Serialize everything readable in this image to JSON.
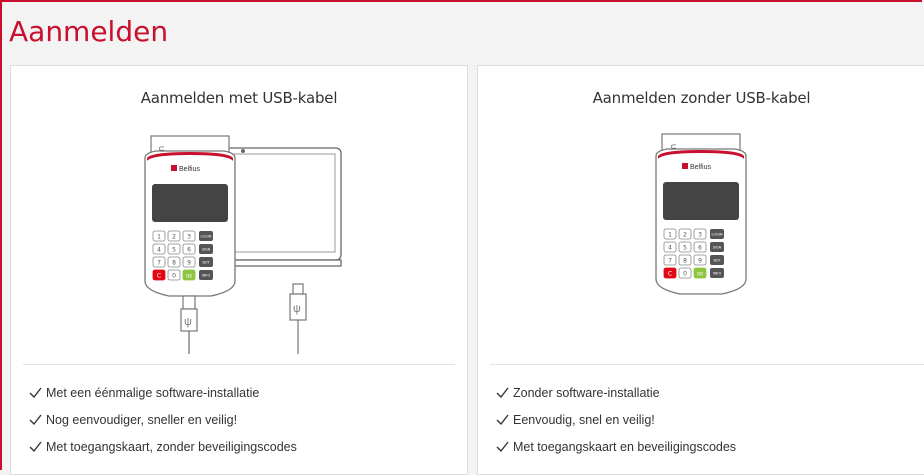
{
  "page": {
    "title": "Aanmelden"
  },
  "cards": [
    {
      "title": "Aanmelden met USB-kabel",
      "features": [
        "Met een éénmalige software-installatie",
        "Nog eenvoudiger, sneller en veilig!",
        "Met toegangskaart, zonder beveiligingscodes"
      ]
    },
    {
      "title": "Aanmelden zonder USB-kabel",
      "features": [
        "Zonder software-installatie",
        "Eenvoudig, snel en veilig!",
        "Met toegangskaart en beveiligingscodes"
      ]
    }
  ],
  "device": {
    "brand": "Belfius",
    "card_label": "US",
    "keys": [
      "1",
      "2",
      "3",
      "4",
      "5",
      "6",
      "7",
      "8",
      "9",
      "C",
      "0",
      "OK"
    ],
    "side_keys": [
      "LOGIN",
      "SIGN",
      "BUY",
      "INFO"
    ],
    "colors": {
      "accent": "#c8102e",
      "ok": "#8cc63f",
      "cancel": "#e30613"
    }
  },
  "icons": {
    "check": "check-icon",
    "usb": "usb-icon"
  }
}
